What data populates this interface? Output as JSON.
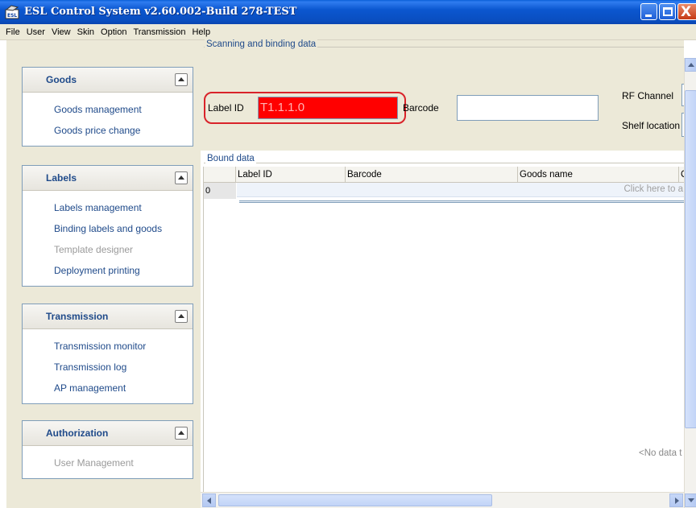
{
  "window": {
    "title": "ESL Control System v2.60.002-Build 278-TEST",
    "controls": {
      "minimize_icon": "minimize-icon",
      "maximize_icon": "maximize-icon",
      "close_glyph": "X"
    }
  },
  "menu": {
    "items": [
      "File",
      "User",
      "View",
      "Skin",
      "Option",
      "Transmission",
      "Help"
    ]
  },
  "sidebar": {
    "groups": [
      {
        "title": "Goods",
        "items": [
          {
            "label": "Goods management"
          },
          {
            "label": "Goods price change"
          }
        ]
      },
      {
        "title": "Labels",
        "items": [
          {
            "label": "Labels management"
          },
          {
            "label": "Binding labels and goods"
          },
          {
            "label": "Template designer",
            "disabled": true
          },
          {
            "label": "Deployment printing"
          }
        ]
      },
      {
        "title": "Transmission",
        "items": [
          {
            "label": "Transmission monitor"
          },
          {
            "label": "Transmission log"
          },
          {
            "label": "AP management"
          }
        ]
      },
      {
        "title": "Authorization",
        "items": [
          {
            "label": "User Management",
            "disabled": true
          }
        ]
      }
    ]
  },
  "scan": {
    "legend": "Scanning and binding data",
    "label_id_label": "Label ID",
    "label_id_value": "T1.1.1.0",
    "barcode_label": "Barcode",
    "barcode_value": "",
    "rf_channel_label": "RF Channel",
    "shelf_location_label": "Shelf location"
  },
  "bound": {
    "legend": "Bound data",
    "columns": [
      "Label ID",
      "Barcode",
      "Goods name",
      "C"
    ],
    "row_number": "0",
    "new_row_text": "Click here to a",
    "empty_text": "<No data t"
  },
  "colors": {
    "highlight_border": "#d9232a",
    "label_id_background": "#ff0000",
    "titlebar": "#0b57d0",
    "link": "#1f4a8a"
  }
}
